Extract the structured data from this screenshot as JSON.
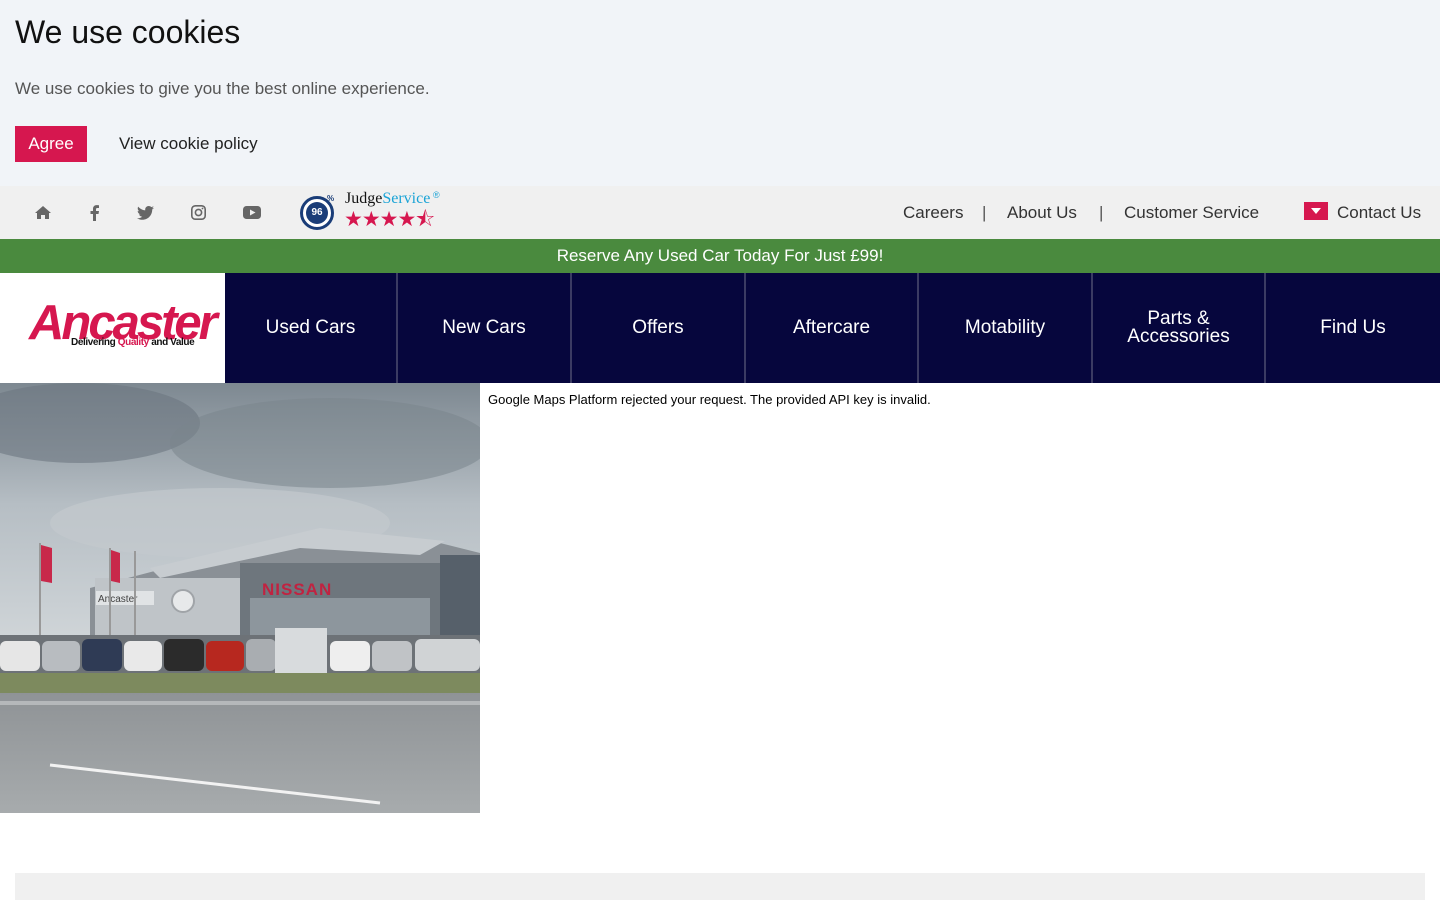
{
  "cookie_banner": {
    "title": "We use cookies",
    "text": "We use cookies to give you the best online experience.",
    "agree_label": "Agree",
    "policy_label": "View cookie policy"
  },
  "utility_bar": {
    "social_icons": [
      "home-icon",
      "facebook-icon",
      "twitter-icon",
      "instagram-icon",
      "youtube-icon"
    ],
    "judge_service": {
      "score": "96",
      "percent": "%",
      "name_a": "Judge",
      "name_b": "Service",
      "reg": "®",
      "stars": "★★★★⯪"
    },
    "links": [
      "Careers",
      "About Us",
      "Customer Service"
    ],
    "separator": "|",
    "contact_label": "Contact Us"
  },
  "promo": {
    "text": "Reserve Any Used Car Today For Just £99!"
  },
  "logo": {
    "word": "Ancaster",
    "tag_a": "Delivering ",
    "tag_b": "Quality",
    "tag_c": " and Value"
  },
  "nav": {
    "items": [
      "Used Cars",
      "New Cars",
      "Offers",
      "Aftercare",
      "Motability",
      "Parts & Accessories",
      "Find Us"
    ]
  },
  "photo": {
    "sign_text": "NISSAN",
    "dealer_sign": "Ancaster"
  },
  "map": {
    "error_text": "Google Maps Platform rejected your request. The provided API key is invalid."
  },
  "colors": {
    "brand": "#d6174f",
    "nav_bg": "#06063d",
    "promo_bg": "#4a8a3e",
    "cookie_bg": "#f1f4f8",
    "utility_bg": "#f0f0f0"
  }
}
